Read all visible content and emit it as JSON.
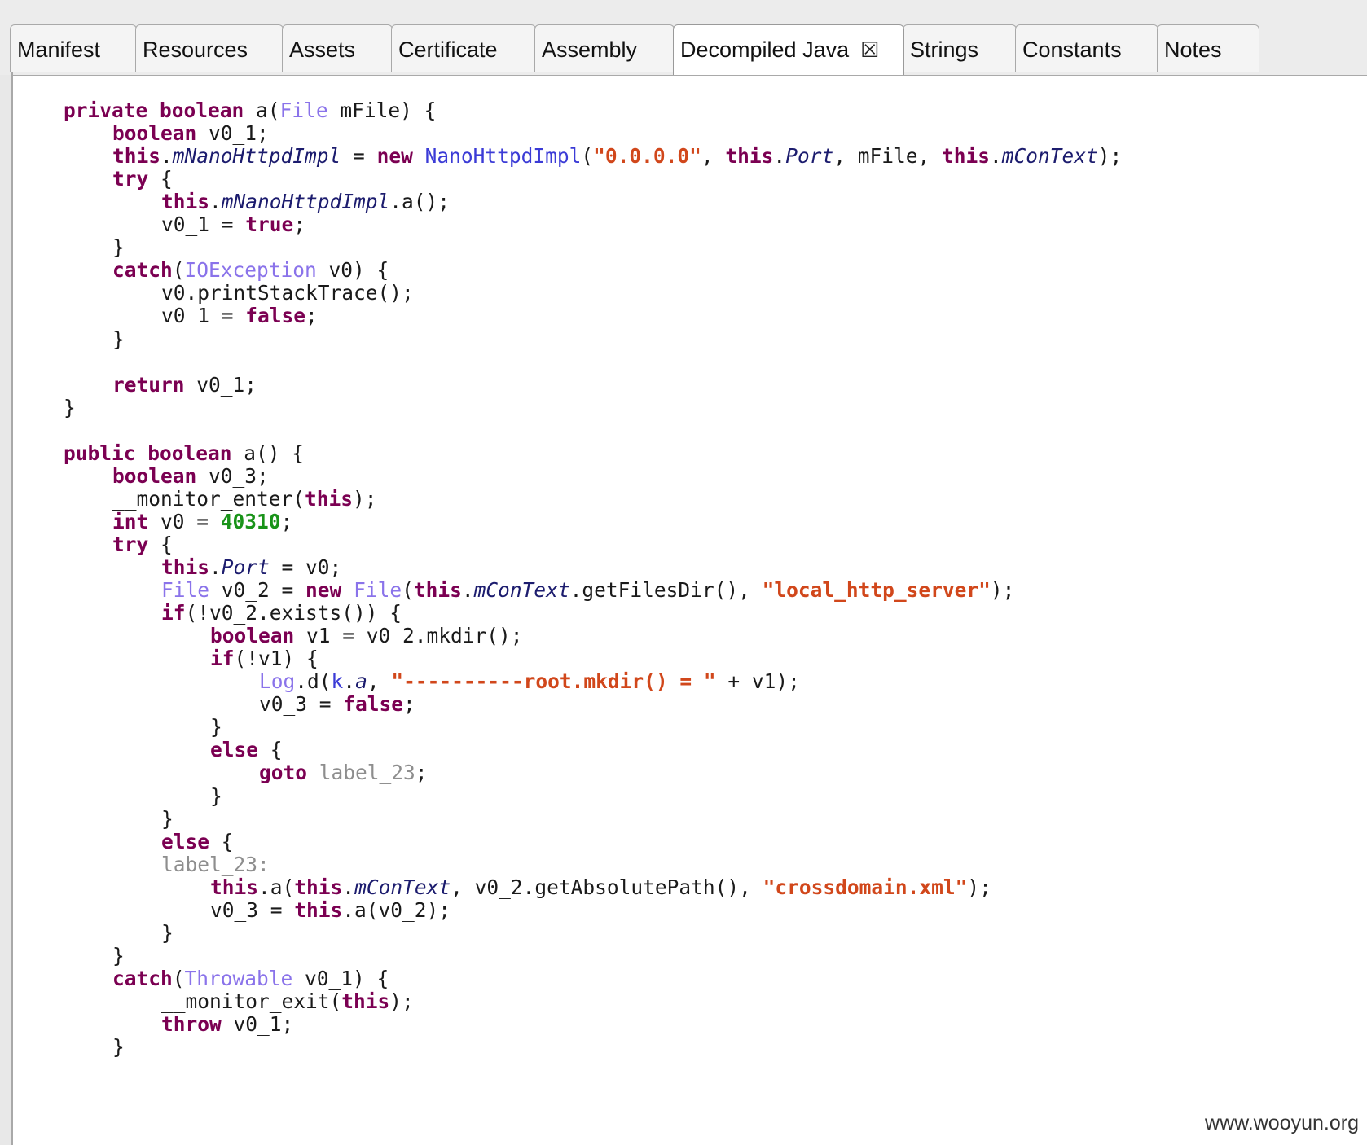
{
  "tabs": [
    {
      "label": "Manifest",
      "active": false
    },
    {
      "label": "Resources",
      "active": false
    },
    {
      "label": "Assets",
      "active": false
    },
    {
      "label": "Certificate",
      "active": false
    },
    {
      "label": "Assembly",
      "active": false
    },
    {
      "label": "Decompiled Java",
      "active": true,
      "closable": true
    },
    {
      "label": "Strings",
      "active": false
    },
    {
      "label": "Constants",
      "active": false
    },
    {
      "label": "Notes",
      "active": false
    }
  ],
  "close_icon": "close-x-icon",
  "code_colors": {
    "keyword": "#7b0052",
    "type": "#8a73ea",
    "class": "#3b3bd6",
    "field": "#1c1c6e",
    "string": "#d1471b",
    "number": "#199319",
    "label": "#8e8e8e"
  },
  "code_lines": [
    {
      "indent": 1,
      "tokens": [
        [
          "kw",
          "private"
        ],
        [
          "pl",
          " "
        ],
        [
          "kw",
          "boolean"
        ],
        [
          "pl",
          " a("
        ],
        [
          "ty",
          "File"
        ],
        [
          "pl",
          " mFile) {"
        ]
      ]
    },
    {
      "indent": 2,
      "tokens": [
        [
          "kw",
          "boolean"
        ],
        [
          "pl",
          " v0_1;"
        ]
      ]
    },
    {
      "indent": 2,
      "tokens": [
        [
          "kw",
          "this"
        ],
        [
          "pl",
          "."
        ],
        [
          "fld",
          "mNanoHttpdImpl"
        ],
        [
          "pl",
          " = "
        ],
        [
          "kw",
          "new"
        ],
        [
          "pl",
          " "
        ],
        [
          "cls",
          "NanoHttpdImpl"
        ],
        [
          "pl",
          "("
        ],
        [
          "str",
          "\"0.0.0.0\""
        ],
        [
          "pl",
          ", "
        ],
        [
          "kw",
          "this"
        ],
        [
          "pl",
          "."
        ],
        [
          "fld",
          "Port"
        ],
        [
          "pl",
          ", mFile, "
        ],
        [
          "kw",
          "this"
        ],
        [
          "pl",
          "."
        ],
        [
          "fld",
          "mConText"
        ],
        [
          "pl",
          ");"
        ]
      ]
    },
    {
      "indent": 2,
      "tokens": [
        [
          "kw",
          "try"
        ],
        [
          "pl",
          " {"
        ]
      ]
    },
    {
      "indent": 3,
      "tokens": [
        [
          "kw",
          "this"
        ],
        [
          "pl",
          "."
        ],
        [
          "fld",
          "mNanoHttpdImpl"
        ],
        [
          "pl",
          ".a();"
        ]
      ]
    },
    {
      "indent": 3,
      "tokens": [
        [
          "pl",
          "v0_1 = "
        ],
        [
          "kw",
          "true"
        ],
        [
          "pl",
          ";"
        ]
      ]
    },
    {
      "indent": 2,
      "tokens": [
        [
          "pl",
          "}"
        ]
      ]
    },
    {
      "indent": 2,
      "tokens": [
        [
          "kw",
          "catch"
        ],
        [
          "pl",
          "("
        ],
        [
          "ty",
          "IOException"
        ],
        [
          "pl",
          " v0) {"
        ]
      ]
    },
    {
      "indent": 3,
      "tokens": [
        [
          "pl",
          "v0.printStackTrace();"
        ]
      ]
    },
    {
      "indent": 3,
      "tokens": [
        [
          "pl",
          "v0_1 = "
        ],
        [
          "kw",
          "false"
        ],
        [
          "pl",
          ";"
        ]
      ]
    },
    {
      "indent": 2,
      "tokens": [
        [
          "pl",
          "}"
        ]
      ]
    },
    {
      "indent": 0,
      "tokens": []
    },
    {
      "indent": 2,
      "tokens": [
        [
          "kw",
          "return"
        ],
        [
          "pl",
          " v0_1;"
        ]
      ]
    },
    {
      "indent": 1,
      "tokens": [
        [
          "pl",
          "}"
        ]
      ]
    },
    {
      "indent": 0,
      "tokens": []
    },
    {
      "indent": 1,
      "tokens": [
        [
          "kw",
          "public"
        ],
        [
          "pl",
          " "
        ],
        [
          "kw",
          "boolean"
        ],
        [
          "pl",
          " a() {"
        ]
      ]
    },
    {
      "indent": 2,
      "tokens": [
        [
          "kw",
          "boolean"
        ],
        [
          "pl",
          " v0_3;"
        ]
      ]
    },
    {
      "indent": 2,
      "tokens": [
        [
          "pl",
          "__monitor_enter("
        ],
        [
          "kw",
          "this"
        ],
        [
          "pl",
          ");"
        ]
      ]
    },
    {
      "indent": 2,
      "tokens": [
        [
          "kw",
          "int"
        ],
        [
          "pl",
          " v0 = "
        ],
        [
          "num",
          "40310"
        ],
        [
          "pl",
          ";"
        ]
      ]
    },
    {
      "indent": 2,
      "tokens": [
        [
          "kw",
          "try"
        ],
        [
          "pl",
          " {"
        ]
      ]
    },
    {
      "indent": 3,
      "tokens": [
        [
          "kw",
          "this"
        ],
        [
          "pl",
          "."
        ],
        [
          "fld",
          "Port"
        ],
        [
          "pl",
          " = v0;"
        ]
      ]
    },
    {
      "indent": 3,
      "tokens": [
        [
          "ty",
          "File"
        ],
        [
          "pl",
          " v0_2 = "
        ],
        [
          "kw",
          "new"
        ],
        [
          "pl",
          " "
        ],
        [
          "ty",
          "File"
        ],
        [
          "pl",
          "("
        ],
        [
          "kw",
          "this"
        ],
        [
          "pl",
          "."
        ],
        [
          "fld",
          "mConText"
        ],
        [
          "pl",
          ".getFilesDir(), "
        ],
        [
          "str",
          "\"local_http_server\""
        ],
        [
          "pl",
          ");"
        ]
      ]
    },
    {
      "indent": 3,
      "tokens": [
        [
          "kw",
          "if"
        ],
        [
          "pl",
          "(!v0_2.exists()) {"
        ]
      ]
    },
    {
      "indent": 4,
      "tokens": [
        [
          "kw",
          "boolean"
        ],
        [
          "pl",
          " v1 = v0_2.mkdir();"
        ]
      ]
    },
    {
      "indent": 4,
      "tokens": [
        [
          "kw",
          "if"
        ],
        [
          "pl",
          "(!v1) {"
        ]
      ]
    },
    {
      "indent": 5,
      "tokens": [
        [
          "ty",
          "Log"
        ],
        [
          "pl",
          ".d("
        ],
        [
          "cls",
          "k"
        ],
        [
          "pl",
          "."
        ],
        [
          "fld",
          "a"
        ],
        [
          "pl",
          ", "
        ],
        [
          "str",
          "\"----------root.mkdir() = \""
        ],
        [
          "pl",
          " + v1);"
        ]
      ]
    },
    {
      "indent": 5,
      "tokens": [
        [
          "pl",
          "v0_3 = "
        ],
        [
          "kw",
          "false"
        ],
        [
          "pl",
          ";"
        ]
      ]
    },
    {
      "indent": 4,
      "tokens": [
        [
          "pl",
          "}"
        ]
      ]
    },
    {
      "indent": 4,
      "tokens": [
        [
          "kw",
          "else"
        ],
        [
          "pl",
          " {"
        ]
      ]
    },
    {
      "indent": 5,
      "tokens": [
        [
          "kw",
          "goto"
        ],
        [
          "pl",
          " "
        ],
        [
          "lbl",
          "label_23"
        ],
        [
          "pl",
          ";"
        ]
      ]
    },
    {
      "indent": 4,
      "tokens": [
        [
          "pl",
          "}"
        ]
      ]
    },
    {
      "indent": 3,
      "tokens": [
        [
          "pl",
          "}"
        ]
      ]
    },
    {
      "indent": 3,
      "tokens": [
        [
          "kw",
          "else"
        ],
        [
          "pl",
          " {"
        ]
      ]
    },
    {
      "indent": 3,
      "tokens": [
        [
          "lbl",
          "label_23:"
        ]
      ]
    },
    {
      "indent": 4,
      "tokens": [
        [
          "kw",
          "this"
        ],
        [
          "pl",
          ".a("
        ],
        [
          "kw",
          "this"
        ],
        [
          "pl",
          "."
        ],
        [
          "fld",
          "mConText"
        ],
        [
          "pl",
          ", v0_2.getAbsolutePath(), "
        ],
        [
          "str",
          "\"crossdomain.xml\""
        ],
        [
          "pl",
          ");"
        ]
      ]
    },
    {
      "indent": 4,
      "tokens": [
        [
          "pl",
          "v0_3 = "
        ],
        [
          "kw",
          "this"
        ],
        [
          "pl",
          ".a(v0_2);"
        ]
      ]
    },
    {
      "indent": 3,
      "tokens": [
        [
          "pl",
          "}"
        ]
      ]
    },
    {
      "indent": 2,
      "tokens": [
        [
          "pl",
          "}"
        ]
      ]
    },
    {
      "indent": 2,
      "tokens": [
        [
          "kw",
          "catch"
        ],
        [
          "pl",
          "("
        ],
        [
          "ty",
          "Throwable"
        ],
        [
          "pl",
          " v0_1) {"
        ]
      ]
    },
    {
      "indent": 3,
      "tokens": [
        [
          "pl",
          "__monitor_exit("
        ],
        [
          "kw",
          "this"
        ],
        [
          "pl",
          ");"
        ]
      ]
    },
    {
      "indent": 3,
      "tokens": [
        [
          "kw",
          "throw"
        ],
        [
          "pl",
          " v0_1;"
        ]
      ]
    },
    {
      "indent": 2,
      "tokens": [
        [
          "pl",
          "}"
        ]
      ]
    }
  ],
  "watermark": "www.wooyun.org"
}
